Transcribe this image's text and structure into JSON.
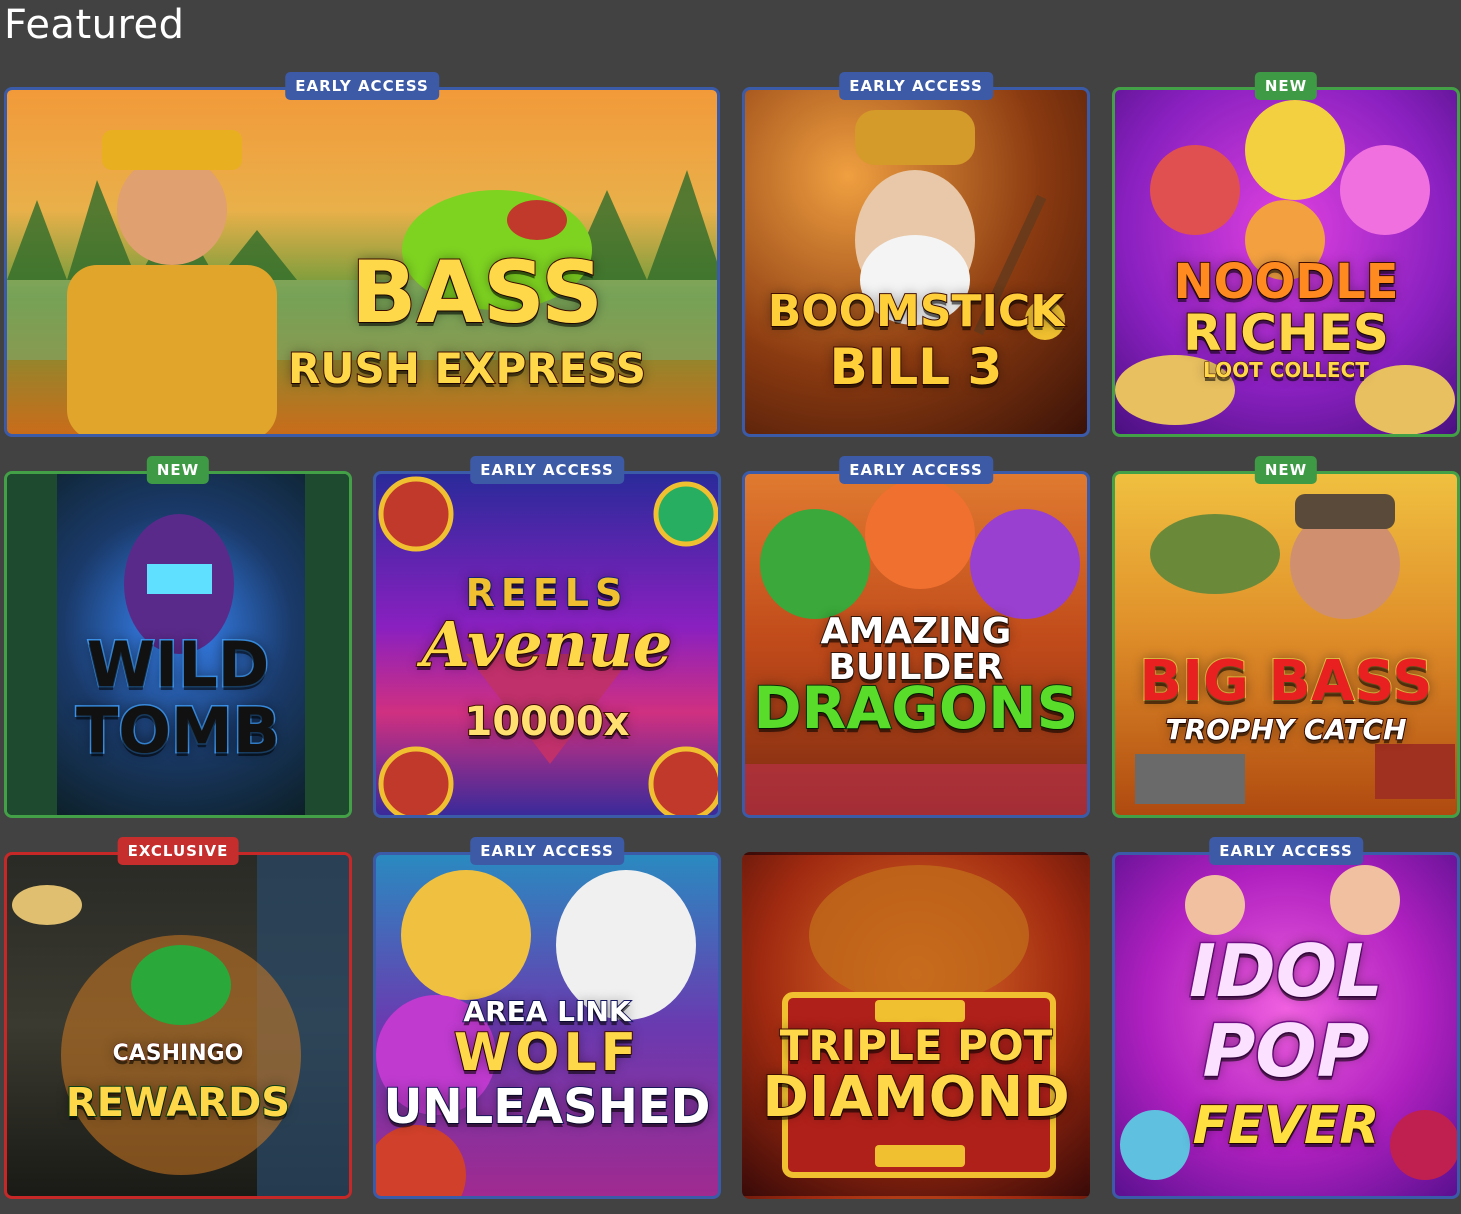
{
  "section": {
    "title": "Featured"
  },
  "colors": {
    "background": "#424242",
    "badge_early_access": "#3d5aa6",
    "badge_new": "#3e9a44",
    "badge_exclusive": "#c62d2d"
  },
  "games": [
    {
      "title_line1": "BASS",
      "title_line2": "RUSH EXPRESS",
      "title_line3": "",
      "badge": "EARLY ACCESS"
    },
    {
      "title_line1": "BOOMSTICK",
      "title_line2": "BILL 3",
      "title_line3": "",
      "badge": "EARLY ACCESS"
    },
    {
      "title_line1": "NOODLE",
      "title_line2": "RICHES",
      "title_line3": "LOOT COLLECT",
      "badge": "NEW"
    },
    {
      "title_line1": "WILD",
      "title_line2": "TOMB",
      "title_line3": "",
      "badge": "NEW"
    },
    {
      "title_line1": "REELS",
      "title_line2": "Avenue",
      "title_line3": "10000x",
      "badge": "EARLY ACCESS"
    },
    {
      "title_line1": "AMAZING BUILDER",
      "title_line2": "DRAGONS",
      "title_line3": "",
      "badge": "EARLY ACCESS"
    },
    {
      "title_line1": "BIG BASS",
      "title_line2": "TROPHY CATCH",
      "title_line3": "",
      "badge": "NEW"
    },
    {
      "title_line1": "CASHINGO",
      "title_line2": "REWARDS",
      "title_line3": "",
      "badge": "EXCLUSIVE"
    },
    {
      "title_line1": "AREA LINK",
      "title_line2": "WOLF",
      "title_line3": "UNLEASHED",
      "badge": "EARLY ACCESS"
    },
    {
      "title_line1": "TRIPLE POT",
      "title_line2": "DIAMOND",
      "title_line3": "",
      "badge": ""
    },
    {
      "title_line1": "IDOL",
      "title_line2": "POP",
      "title_line3": "FEVER",
      "badge": "EARLY ACCESS"
    }
  ]
}
